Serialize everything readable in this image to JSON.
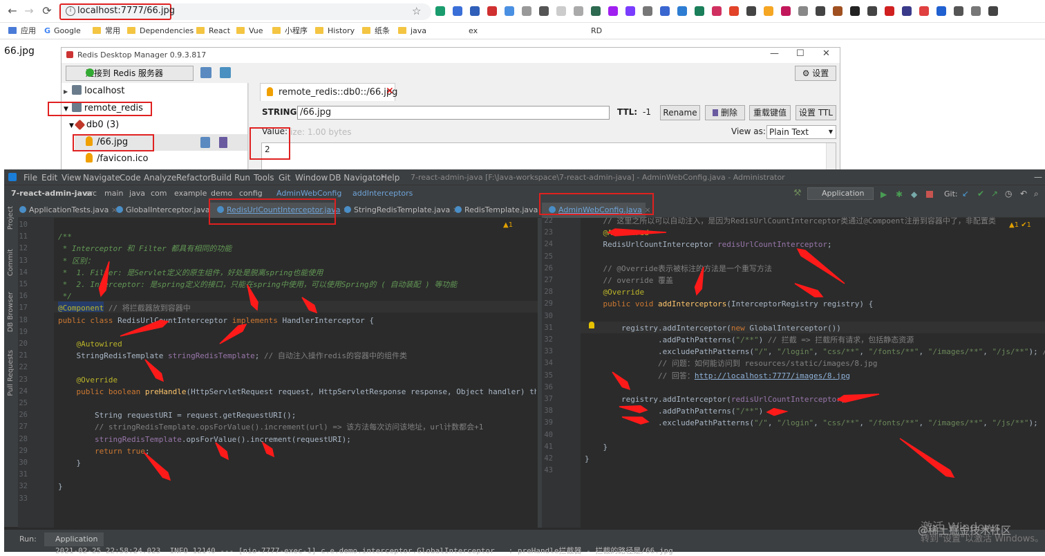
{
  "browser": {
    "url": "localhost:7777/66.jpg",
    "bookmarks": [
      "应用",
      "Google",
      "常用",
      "Dependencies",
      "React",
      "Vue",
      "小程序",
      "History",
      "纸条",
      "java",
      "ex",
      "RD"
    ]
  },
  "page": {
    "title": "66.jpg"
  },
  "rdm": {
    "window_title": "Redis Desktop Manager 0.9.3.817",
    "connect_label": "连接到 Redis 服务器",
    "settings_label": "设置",
    "tree": [
      {
        "label": "localhost"
      },
      {
        "label": "remote_redis"
      },
      {
        "label": "db0  (3)"
      },
      {
        "label": "/66.jpg"
      },
      {
        "label": "/favicon.ico"
      }
    ],
    "tab_label": "remote_redis::db0::/66.jpg",
    "string_label": "STRING:",
    "key_value": "/66.jpg",
    "ttl_label": "TTL:",
    "ttl_value": "-1",
    "buttons": {
      "rename": "Rename",
      "delete": "删除",
      "reload": "重载键值",
      "set_ttl": "设置 TTL"
    },
    "value_label": "Value:",
    "size_text": "ize: 1.00 bytes",
    "view_as_label": "View as:",
    "view_as_value": "Plain Text",
    "value_content": "2"
  },
  "ide": {
    "menu": [
      "File",
      "Edit",
      "View",
      "Navigate",
      "Code",
      "Analyze",
      "Refactor",
      "Build",
      "Run",
      "Tools",
      "Git",
      "Window",
      "DB Navigator",
      "Help"
    ],
    "title": "7-react-admin-java [F:\\Java-workspace\\7-react-admin-java] - AdminWebConfig.java - Administrator",
    "breadcrumbs": [
      "7-react-admin-java",
      "src",
      "main",
      "java",
      "com",
      "example",
      "demo",
      "config",
      "AdminWebConfig",
      "addInterceptors"
    ],
    "run_config": "Application",
    "git_label": "Git:",
    "tabs": [
      "ApplicationTests.java",
      "GlobalInterceptor.java",
      "RedisUrlCountInterceptor.java",
      "StringRedisTemplate.java",
      "RedisTemplate.java",
      "AdminWebConfig.java"
    ],
    "side_labels": [
      "Project",
      "Commit",
      "DB Browser",
      "Pull Requests"
    ],
    "left_inspect": "▲1",
    "right_inspect": "▲1 ✔1",
    "left_lines": [
      {
        "n": "10",
        "t": ""
      },
      {
        "n": "11",
        "t": "/**"
      },
      {
        "n": "12",
        "t": " * Interceptor 和 Filter 都具有相同的功能"
      },
      {
        "n": "13",
        "t": " * 区别："
      },
      {
        "n": "14",
        "t": " *  1. Filter: 是Servlet定义的原生组件，好处是脱离spring也能使用"
      },
      {
        "n": "15",
        "t": " *  2. Interceptor: 是spring定义的接口，只能在spring中使用，可以使用Spring的 ( 自动装配 ) 等功能"
      },
      {
        "n": "16",
        "t": " */"
      },
      {
        "n": "17",
        "t": "@Component // 将拦截器放到容器中"
      },
      {
        "n": "18",
        "t": "public class RedisUrlCountInterceptor implements HandlerInterceptor {"
      },
      {
        "n": "19",
        "t": ""
      },
      {
        "n": "20",
        "t": "    @Autowired"
      },
      {
        "n": "21",
        "t": "    StringRedisTemplate stringRedisTemplate; // 自动注入操作redis的容器中的组件类"
      },
      {
        "n": "22",
        "t": ""
      },
      {
        "n": "23",
        "t": "    @Override"
      },
      {
        "n": "24",
        "t": "    public boolean preHandle(HttpServletRequest request, HttpServletResponse response, Object handler) thro"
      },
      {
        "n": "25",
        "t": ""
      },
      {
        "n": "26",
        "t": "        String requestURI = request.getRequestURI();"
      },
      {
        "n": "27",
        "t": "        // stringRedisTemplate.opsForValue().increment(url) => 该方法每次访问该地址，url计数都会+1"
      },
      {
        "n": "28",
        "t": "        stringRedisTemplate.opsForValue().increment(requestURI);"
      },
      {
        "n": "29",
        "t": "        return true;"
      },
      {
        "n": "30",
        "t": "    }"
      },
      {
        "n": "31",
        "t": ""
      },
      {
        "n": "32",
        "t": "}"
      },
      {
        "n": "33",
        "t": ""
      }
    ],
    "right_lines": [
      {
        "n": "22",
        "t": "    // 这里之所以可以自动注入，是因为RedisUrlCountInterceptor类通过@Compoent注册到容器中了，非配置类"
      },
      {
        "n": "23",
        "t": "    @Autowired"
      },
      {
        "n": "24",
        "t": "    RedisUrlCountInterceptor redisUrlCountInterceptor;"
      },
      {
        "n": "25",
        "t": ""
      },
      {
        "n": "26",
        "t": "    // @Override表示被标注的方法是一个重写方法"
      },
      {
        "n": "27",
        "t": "    // override 覆盖"
      },
      {
        "n": "28",
        "t": "    @Override"
      },
      {
        "n": "29",
        "t": "    public void addInterceptors(InterceptorRegistry registry) {"
      },
      {
        "n": "30",
        "t": ""
      },
      {
        "n": "31",
        "t": "        registry.addInterceptor(new GlobalInterceptor())"
      },
      {
        "n": "32",
        "t": "                .addPathPatterns(\"/**\") // 拦截 => 拦截所有请求，包括静态资源"
      },
      {
        "n": "33",
        "t": "                .excludePathPatterns(\"/\", \"/login\", \"css/**\", \"/fonts/**\", \"/images/**\", \"/js/**\"); //"
      },
      {
        "n": "34",
        "t": "                // 问题：如何能访问到 resources/static/images/8.jpg"
      },
      {
        "n": "35",
        "t": "                // 回答：http://localhost:7777/images/8.jpg"
      },
      {
        "n": "36",
        "t": ""
      },
      {
        "n": "37",
        "t": "        registry.addInterceptor(redisUrlCountInterceptor)"
      },
      {
        "n": "38",
        "t": "                .addPathPatterns(\"/**\")"
      },
      {
        "n": "39",
        "t": "                .excludePathPatterns(\"/\", \"/login\", \"css/**\", \"/fonts/**\", \"/images/**\", \"/js/**\");"
      },
      {
        "n": "40",
        "t": ""
      },
      {
        "n": "41",
        "t": "    }"
      },
      {
        "n": "42",
        "t": "}"
      },
      {
        "n": "43",
        "t": ""
      }
    ],
    "run_label": "Run:",
    "run_tab": "Application",
    "console_line": "2021-02-25 22:58:24.023  INFO 12140 --- [nio-7777-exec-1] c.e.demo.interceptor.GlobalInterceptor   : preHandle拦截器 - 拦截的路径是/66.jpg"
  },
  "watermark": {
    "line1": "激活 Windows",
    "line2": "转到\"设置\"以激活 Windows。",
    "site": "@稀土掘金技术社区"
  }
}
